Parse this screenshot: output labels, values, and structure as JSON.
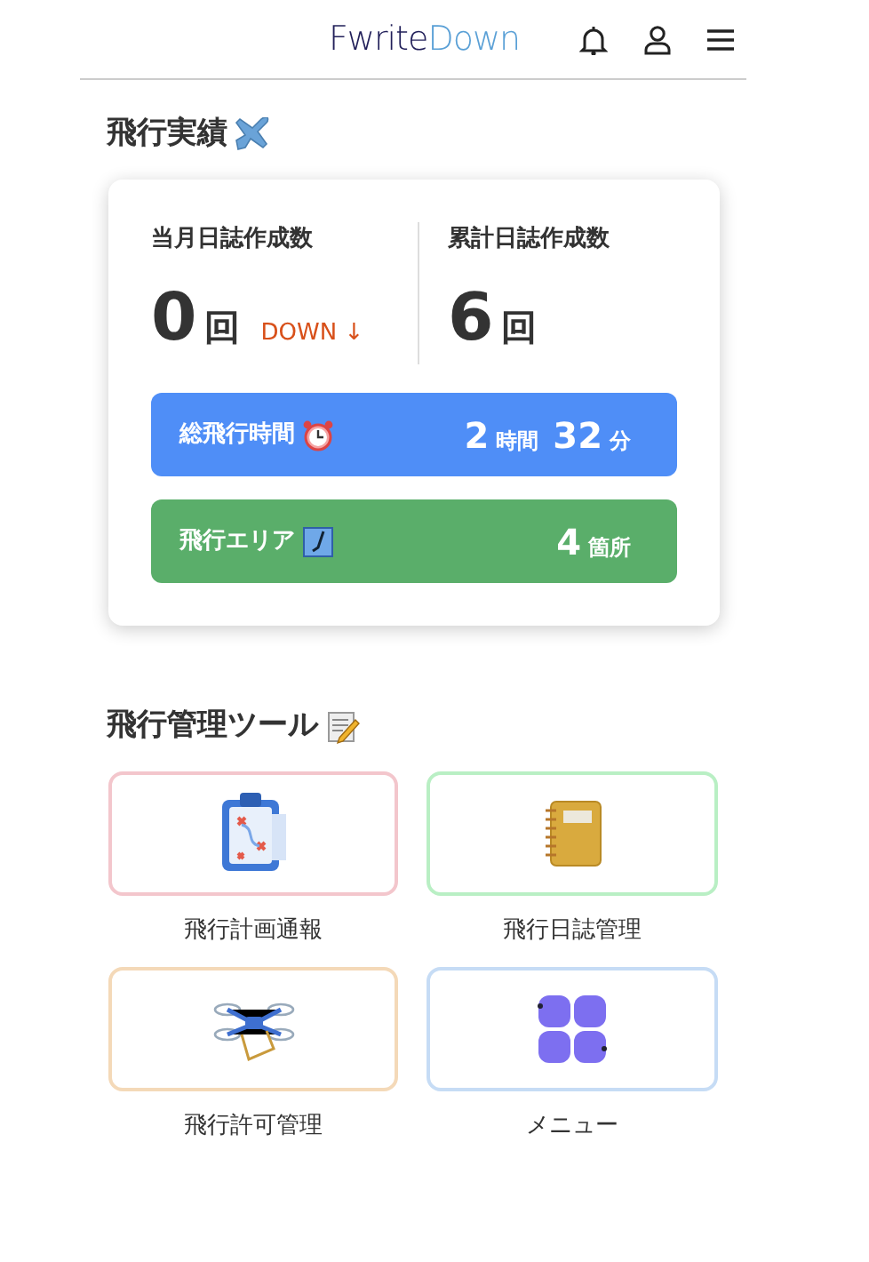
{
  "header": {
    "logo_left": "Fwrite",
    "logo_right": "Down"
  },
  "results": {
    "title": "飛行実績",
    "stats": [
      {
        "label": "当月日誌作成数",
        "value": "0",
        "unit": "回",
        "trend": "DOWN ↓"
      },
      {
        "label": "累計日誌作成数",
        "value": "6",
        "unit": "回"
      }
    ],
    "bars": [
      {
        "kind": "time",
        "label": "総飛行時間",
        "color": "#4f8ef7",
        "parts": [
          {
            "value": "2",
            "unit": "時間"
          },
          {
            "value": "32",
            "unit": "分"
          }
        ]
      },
      {
        "kind": "area",
        "label": "飛行エリア",
        "color": "#5aae6a",
        "parts": [
          {
            "value": "4",
            "unit": "箇所"
          }
        ]
      }
    ]
  },
  "tools": {
    "title": "飛行管理ツール",
    "items": [
      {
        "kind": "plan",
        "label": "飛行計画通報",
        "color": "#f3c6cc"
      },
      {
        "kind": "log",
        "label": "飛行日誌管理",
        "color": "#b9efc4"
      },
      {
        "kind": "drone",
        "label": "飛行許可管理",
        "color": "#f4d9b8"
      },
      {
        "kind": "menu",
        "label": "メニュー",
        "color": "#c6dcf5"
      }
    ]
  }
}
